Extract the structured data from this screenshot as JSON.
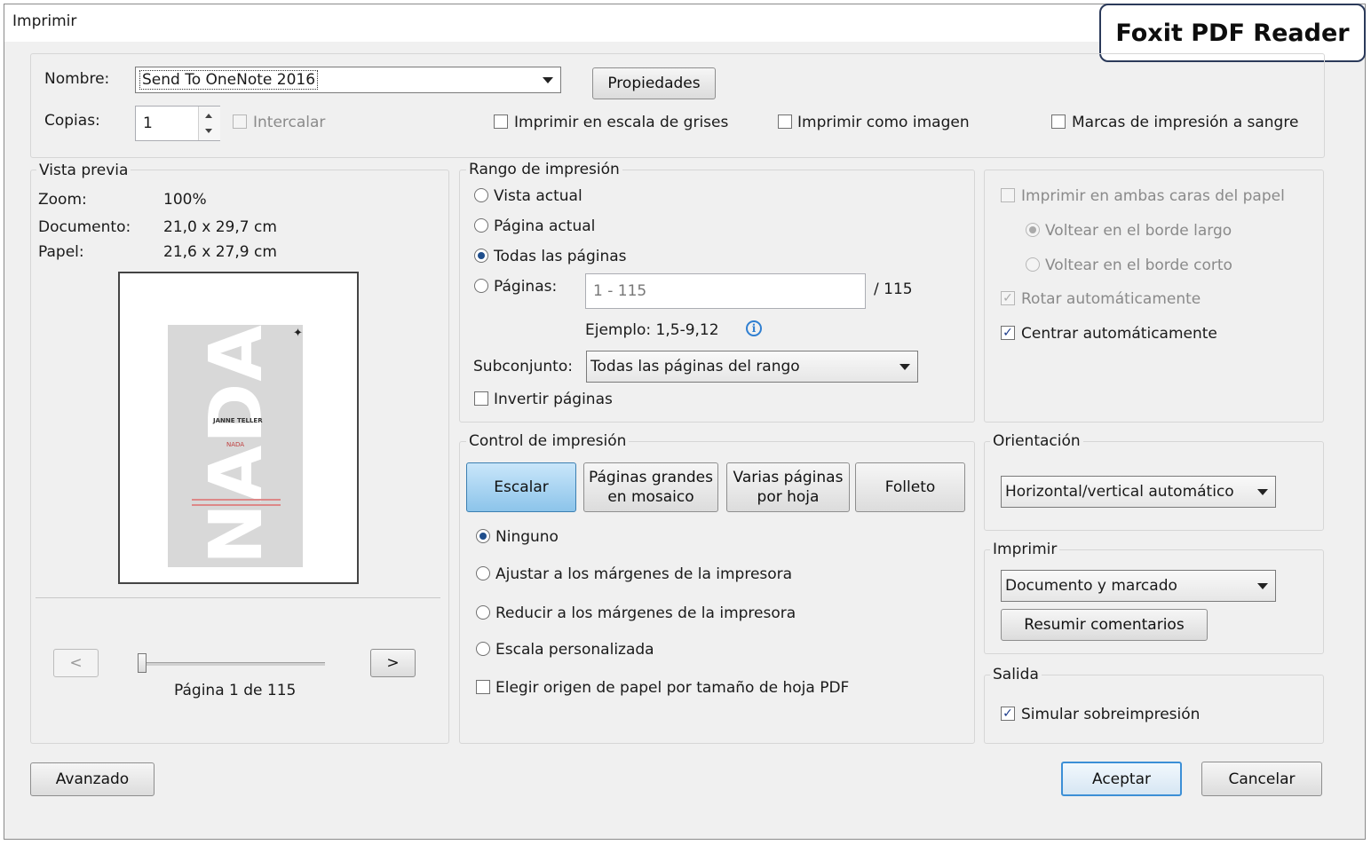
{
  "window": {
    "title": "Imprimir"
  },
  "brand": {
    "label": "Foxit PDF Reader"
  },
  "printer": {
    "name_label": "Nombre:",
    "name_value": "Send To OneNote 2016",
    "properties_button": "Propiedades",
    "copies_label": "Copias:",
    "copies_value": "1",
    "collate_label": "Intercalar",
    "grayscale_label": "Imprimir en escala de grises",
    "as_image_label": "Imprimir como imagen",
    "bleed_marks_label": "Marcas de impresión a sangre"
  },
  "preview": {
    "group_label": "Vista previa",
    "zoom_label": "Zoom:",
    "zoom_value": "100%",
    "document_label": "Documento:",
    "document_value": "21,0 x 29,7 cm",
    "paper_label": "Papel:",
    "paper_value": "21,6 x 27,9 cm",
    "cover_title": "NADA",
    "cover_author": "JANNE TELLER",
    "cover_subtitle": "NADA",
    "prev_button": "<",
    "next_button": ">",
    "page_status": "Página 1 de 115",
    "page_position": 0.0
  },
  "range": {
    "group_label": "Rango de impresión",
    "current_view": "Vista actual",
    "current_page": "Página actual",
    "all_pages": "Todas las páginas",
    "pages_label": "Páginas:",
    "pages_value": "1 - 115",
    "pages_total": "/ 115",
    "example": "Ejemplo: 1,5-9,12",
    "subset_label": "Subconjunto:",
    "subset_value": "Todas las páginas del rango",
    "reverse_label": "Invertir páginas",
    "selected": "all_pages"
  },
  "duplex": {
    "both_sides_label": "Imprimir en ambas caras del papel",
    "long_edge_label": "Voltear en el borde largo",
    "short_edge_label": "Voltear en el borde corto",
    "auto_rotate_label": "Rotar automáticamente",
    "auto_center_label": "Centrar automáticamente"
  },
  "control": {
    "group_label": "Control de impresión",
    "tabs": {
      "scale": "Escalar",
      "tile": "Páginas grandes\nen mosaico",
      "multiple": "Varias páginas\npor hoja",
      "booklet": "Folleto"
    },
    "none_label": "Ninguno",
    "fit_label": "Ajustar a los márgenes de la impresora",
    "shrink_label": "Reducir a los márgenes de la impresora",
    "custom_label": "Escala personalizada",
    "paper_source_label": "Elegir origen de papel por tamaño de hoja PDF"
  },
  "orientation": {
    "group_label": "Orientación",
    "value": "Horizontal/vertical automático"
  },
  "print_what": {
    "group_label": "Imprimir",
    "value": "Documento y marcado",
    "summarize_button": "Resumir comentarios"
  },
  "output": {
    "group_label": "Salida",
    "simulate_label": "Simular sobreimpresión"
  },
  "footer": {
    "advanced_button": "Avanzado",
    "ok_button": "Aceptar",
    "cancel_button": "Cancelar"
  },
  "icons": {
    "info": "info-icon",
    "spinner_up": "spinner-up-icon",
    "spinner_down": "spinner-down-icon"
  },
  "colors": {
    "accent": "#3c8fd6",
    "selected_tab": "#8cc4ea",
    "info": "#2f7fd1"
  }
}
